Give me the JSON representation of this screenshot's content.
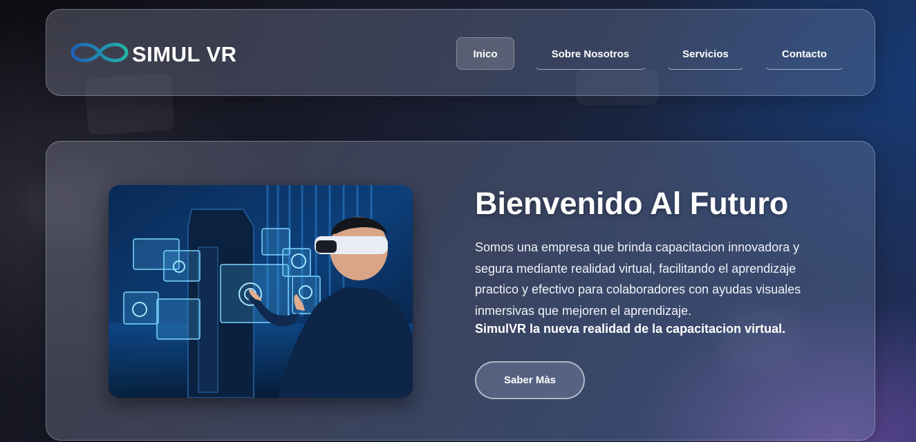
{
  "brand": {
    "name": "SIMUL VR",
    "logo_icon": "infinity-icon",
    "logo_colors": [
      "#1f5fb8",
      "#22b3a6"
    ]
  },
  "nav": {
    "items": [
      {
        "label": "Inico",
        "active": true
      },
      {
        "label": "Sobre Nosotros",
        "active": false
      },
      {
        "label": "Servicios",
        "active": false
      },
      {
        "label": "Contacto",
        "active": false
      }
    ]
  },
  "hero": {
    "title": "Bienvenido Al Futuro",
    "description": "Somos una empresa que brinda capacitacion innovadora y segura mediante realidad virtual, facilitando el aprendizaje practico y efectivo para colaboradores con ayudas visuales inmersivas que mejoren el aprendizaje.",
    "tagline": "SimulVR la nueva realidad de la capacitacion virtual.",
    "cta_label": "Saber Màs",
    "image_icon": "vr-user-holographic-screens-image"
  },
  "colors": {
    "accent_blue": "#1f5fb8",
    "accent_teal": "#22b3a6",
    "text": "#ffffff"
  }
}
